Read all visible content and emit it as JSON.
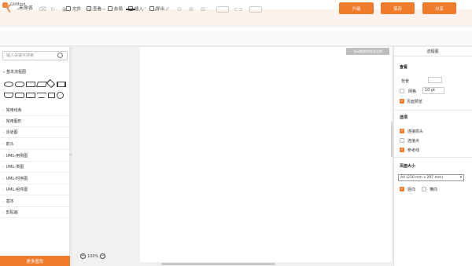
{
  "app": {
    "title": "GitMind"
  },
  "header": {
    "doc_name": "未命名",
    "menus": [
      "文件",
      "查看",
      "布局",
      "插入",
      "导出"
    ],
    "buttons": {
      "upgrade": "升级",
      "save": "保存",
      "share": "分享"
    }
  },
  "left_panel": {
    "search_placeholder": "输入关键字搜索",
    "basic_flowchart": "基本流程图",
    "sections": [
      "常用线条",
      "常用图形",
      "泳道图",
      "箭头",
      "UML-用例图",
      "UML-类图",
      "UML-时序图",
      "UML-组件图",
      "基本",
      "剪贴画"
    ],
    "more_shapes": "更多图形"
  },
  "canvas": {
    "fit_button": "自动缩放到合适比例",
    "zoom_level": "100%"
  },
  "right_panel": {
    "title": "流程图",
    "view_title": "查看",
    "background_label": "背景",
    "grid_label": "网格",
    "grid_size": "10 pt",
    "page_preview": "页面预览",
    "options_title": "选项",
    "connect_arrow": "连接箭头",
    "connect_point": "连接点",
    "guide_line": "参考线",
    "page_size_title": "页面大小",
    "page_size_value": "A4 (210 mm x 297 mm)",
    "portrait": "竖向",
    "landscape": "横向"
  },
  "colors": {
    "accent": "#f07b2c",
    "header_bg": "#fdf3ec"
  }
}
